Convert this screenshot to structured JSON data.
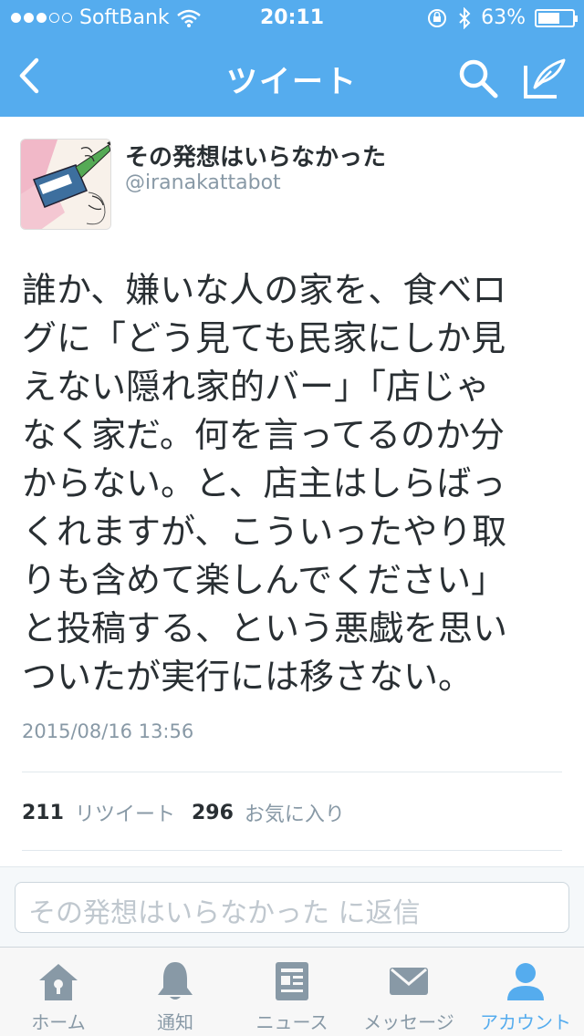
{
  "status_bar": {
    "carrier": "SoftBank",
    "time": "20:11",
    "battery": "63%",
    "battery_level": 0.63
  },
  "nav": {
    "title": "ツイート",
    "icons": [
      "back-chevron-icon",
      "search-icon",
      "compose-tweet-icon"
    ]
  },
  "tweet": {
    "name": "その発想はいらなかった",
    "handle": "@iranakattabot",
    "text_lines": [
      "誰か、嫌いな人の家を、食べロ",
      "グに「どう見ても民家にしか見",
      "えない隠れ家的バー」「店じゃ",
      "なく家だ。何を言ってるのか分",
      "からない。と、店主はしらばっ",
      "くれますが、こういったやり取",
      "りも含めて楽しんでください」",
      "と投稿する、という悪戯を思い",
      "ついたが実行には移さない。"
    ],
    "timestamp": "2015/08/16 13:56",
    "retweets": "211",
    "retweets_label": "リツイート",
    "favorites": "296",
    "favorites_label": "お気に入り"
  },
  "reply": {
    "placeholder": "その発想はいらなかった に返信"
  },
  "tabbar": {
    "items": [
      {
        "label": "ホーム",
        "icon": "home-icon"
      },
      {
        "label": "通知",
        "icon": "bell-icon"
      },
      {
        "label": "ニュース",
        "icon": "news-icon"
      },
      {
        "label": "メッセージ",
        "icon": "envelope-icon"
      },
      {
        "label": "アカウント",
        "icon": "person-icon",
        "active": true
      }
    ]
  },
  "colors": {
    "brand": "#55acee",
    "text": "#292f33",
    "muted": "#8899a6"
  }
}
